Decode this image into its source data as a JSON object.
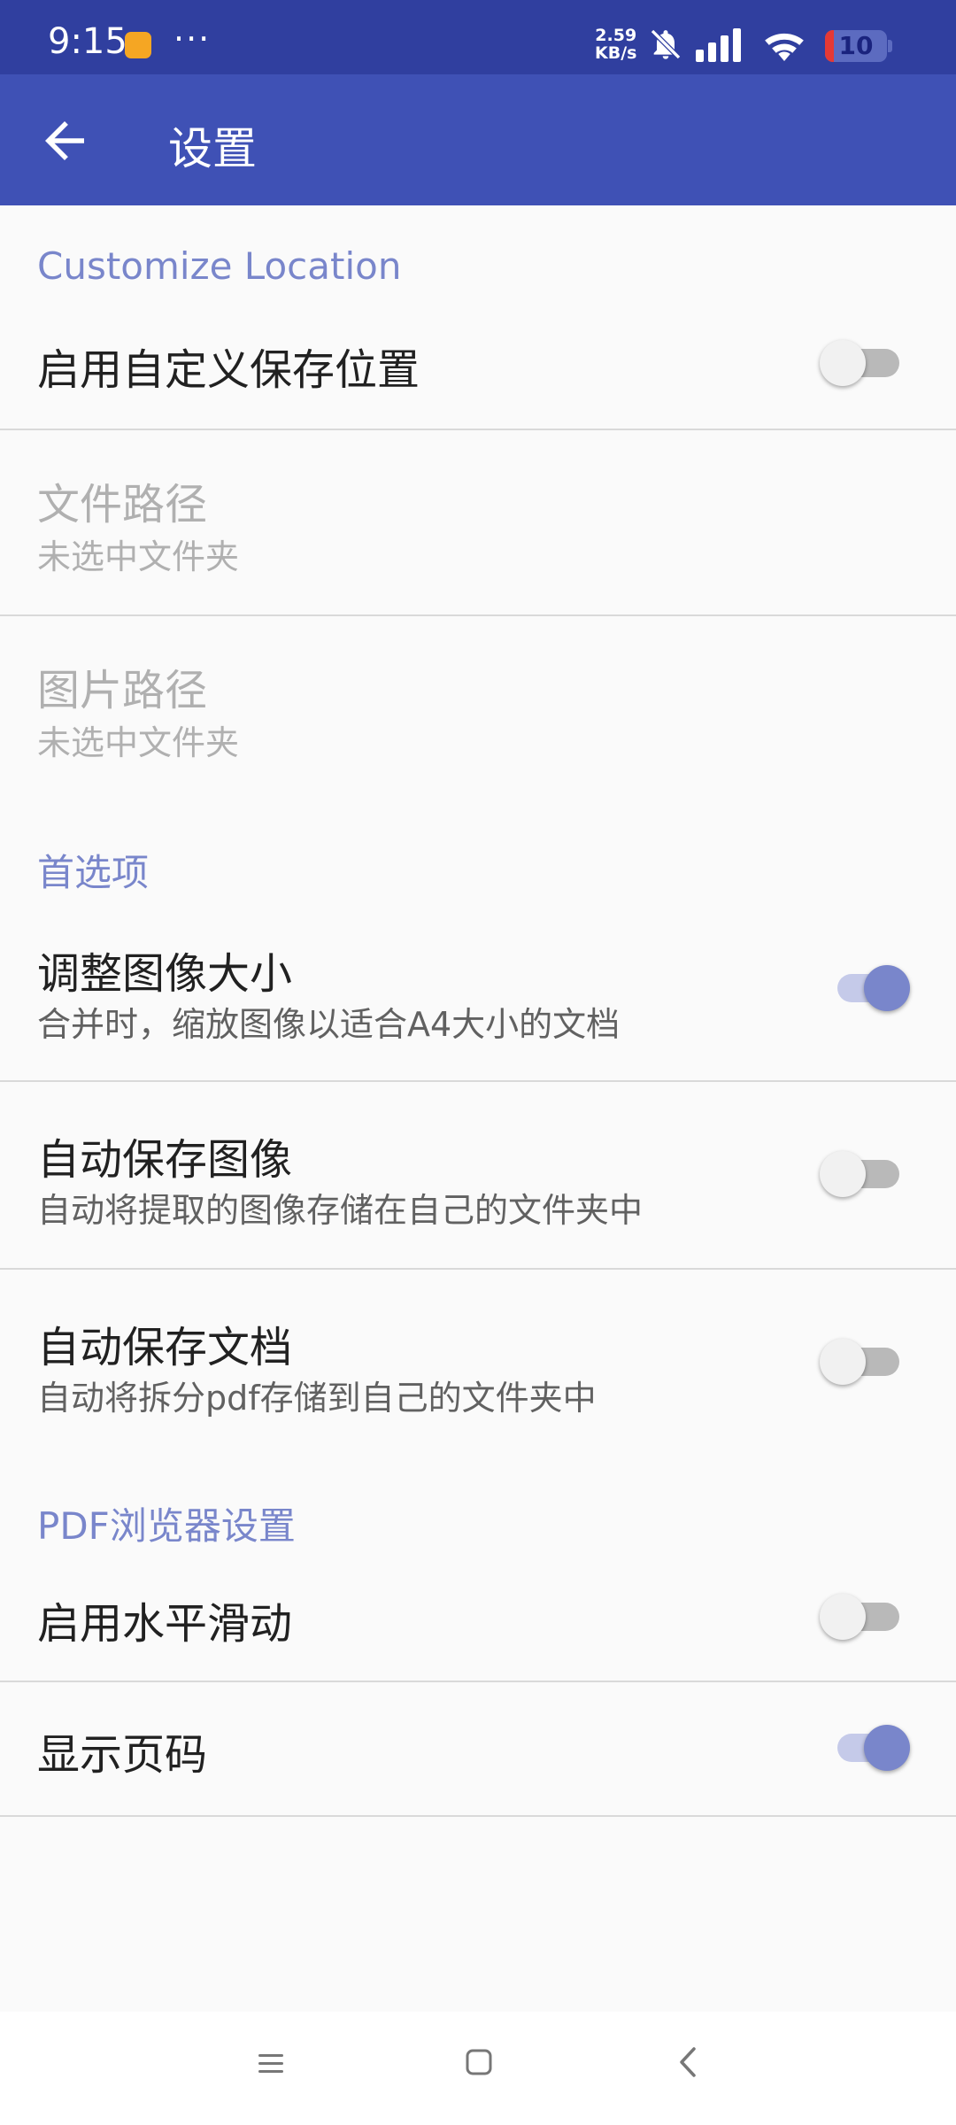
{
  "status_bar": {
    "time": "9:15",
    "more_indicator": "···",
    "net_speed_value": "2.59",
    "net_speed_unit": "KB/s",
    "battery": "10",
    "icons": [
      "app-notification-icon",
      "mute-icon",
      "signal-icon",
      "wifi-icon",
      "battery-icon"
    ]
  },
  "app_bar": {
    "title": "设置",
    "back_icon": "arrow-back-icon"
  },
  "sections": {
    "customize_location": {
      "header": "Customize Location",
      "enable_custom_location": {
        "title": "启用自定义保存位置",
        "checked": false
      },
      "file_path": {
        "title": "文件路径",
        "summary": "未选中文件夹",
        "enabled": false
      },
      "image_path": {
        "title": "图片路径",
        "summary": "未选中文件夹",
        "enabled": false
      }
    },
    "preferences": {
      "header": "首选项",
      "resize_images": {
        "title": "调整图像大小",
        "summary": "合并时，缩放图像以适合A4大小的文档",
        "checked": true
      },
      "auto_save_images": {
        "title": "自动保存图像",
        "summary": "自动将提取的图像存储在自己的文件夹中",
        "checked": false
      },
      "auto_save_docs": {
        "title": "自动保存文档",
        "summary": "自动将拆分pdf存储到自己的文件夹中",
        "checked": false
      }
    },
    "pdf_viewer": {
      "header": "PDF浏览器设置",
      "horizontal_swipe": {
        "title": "启用水平滑动",
        "checked": false
      },
      "show_page_number": {
        "title": "显示页码",
        "checked": true
      }
    }
  },
  "nav_bar": {
    "icons": [
      "menu-icon",
      "home-icon",
      "back-icon"
    ]
  },
  "colors": {
    "status_bar": "#303f9f",
    "app_bar": "#3f51b5",
    "accent": "#7986cb",
    "background": "#fafafa"
  }
}
